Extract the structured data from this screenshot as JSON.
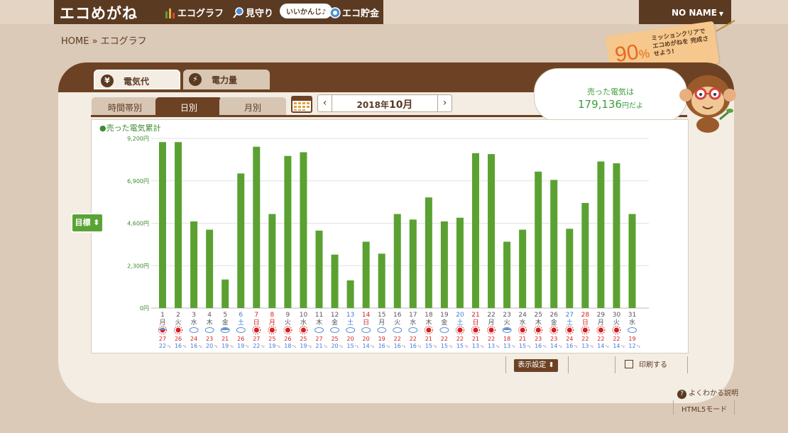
{
  "header": {
    "logo": "エコめがね",
    "nav": [
      {
        "label": "エコグラフ"
      },
      {
        "label": "見守り"
      },
      {
        "label": "エコ貯金"
      }
    ],
    "bubble": "いいかんじ♪",
    "user": "NO NAME"
  },
  "breadcrumb": "HOME » エコグラフ",
  "mission": {
    "percent": "90",
    "percent_sign": "%",
    "text": "ミッションクリアで エコめがねを 完成させよう!"
  },
  "tabs": {
    "price": "電気代",
    "price_icon": "¥",
    "power": "電力量",
    "power_icon": "⚡"
  },
  "subtabs": {
    "hour": "時間帯別",
    "day": "日別",
    "month": "月別"
  },
  "date": {
    "year": "2018年",
    "month": "10月",
    "prev": "‹",
    "next": "›"
  },
  "sold": {
    "label": "売った電気は",
    "value": "179,136",
    "suffix": "円だよ"
  },
  "target_button": "目標",
  "display_button": "表示設定",
  "print_button": "印刷する",
  "help_link": "よくわかる説明",
  "html5_link": "HTML5モード",
  "chart_data": {
    "type": "bar",
    "title": "●売った電気累計",
    "ylim": [
      0,
      9200
    ],
    "yticks": [
      "0円",
      "2,300円",
      "4,600円",
      "6,900円",
      "9,200円"
    ],
    "ytick_values": [
      0,
      2300,
      4600,
      6900,
      9200
    ],
    "color": "#5aa132",
    "days": [
      "1",
      "2",
      "3",
      "4",
      "5",
      "6",
      "7",
      "8",
      "9",
      "10",
      "11",
      "12",
      "13",
      "14",
      "15",
      "16",
      "17",
      "18",
      "19",
      "20",
      "21",
      "22",
      "23",
      "24",
      "25",
      "26",
      "27",
      "28",
      "29",
      "30",
      "31"
    ],
    "weekdays": [
      "月",
      "火",
      "水",
      "木",
      "金",
      "土",
      "日",
      "月",
      "火",
      "水",
      "木",
      "金",
      "土",
      "日",
      "月",
      "火",
      "水",
      "木",
      "金",
      "土",
      "日",
      "月",
      "火",
      "水",
      "木",
      "金",
      "土",
      "日",
      "月",
      "火",
      "水"
    ],
    "day_colors": [
      "n",
      "n",
      "n",
      "n",
      "n",
      "sat",
      "sun",
      "sun",
      "n",
      "n",
      "n",
      "n",
      "sat",
      "sun",
      "n",
      "n",
      "n",
      "n",
      "n",
      "sat",
      "sun",
      "n",
      "n",
      "n",
      "n",
      "n",
      "sat",
      "sun",
      "n",
      "n",
      "n"
    ],
    "weather": [
      "rain-sun",
      "sun",
      "cloud",
      "cloud",
      "rain",
      "cloud",
      "sun",
      "sun",
      "sun",
      "sun",
      "cloud",
      "cloud",
      "cloud",
      "cloud",
      "cloud",
      "cloud",
      "cloud",
      "sun",
      "cloud",
      "sun",
      "sun",
      "sun",
      "rain",
      "sun",
      "sun",
      "sun",
      "sun",
      "sun",
      "sun",
      "sun",
      "cloud"
    ],
    "high_temps": [
      "27",
      "26",
      "24",
      "23",
      "21",
      "26",
      "27",
      "25",
      "26",
      "25",
      "27",
      "25",
      "20",
      "20",
      "19",
      "22",
      "22",
      "21",
      "22",
      "22",
      "21",
      "22",
      "18",
      "21",
      "23",
      "23",
      "24",
      "22",
      "22",
      "22",
      "19"
    ],
    "low_temps": [
      "22",
      "16",
      "16",
      "20",
      "19",
      "19",
      "22",
      "19",
      "18",
      "19",
      "21",
      "20",
      "15",
      "14",
      "16",
      "16",
      "16",
      "15",
      "15",
      "15",
      "13",
      "13",
      "13",
      "15",
      "16",
      "14",
      "16",
      "13",
      "14",
      "14",
      "12"
    ],
    "temp_unit": "°c",
    "values": [
      9000,
      9000,
      4700,
      4250,
      1550,
      7300,
      8750,
      5100,
      8250,
      8450,
      4200,
      2900,
      1500,
      3600,
      2950,
      5100,
      4800,
      6000,
      4700,
      4900,
      8400,
      8350,
      3600,
      4250,
      7400,
      6950,
      4300,
      5700,
      7950,
      7850,
      5100
    ]
  }
}
